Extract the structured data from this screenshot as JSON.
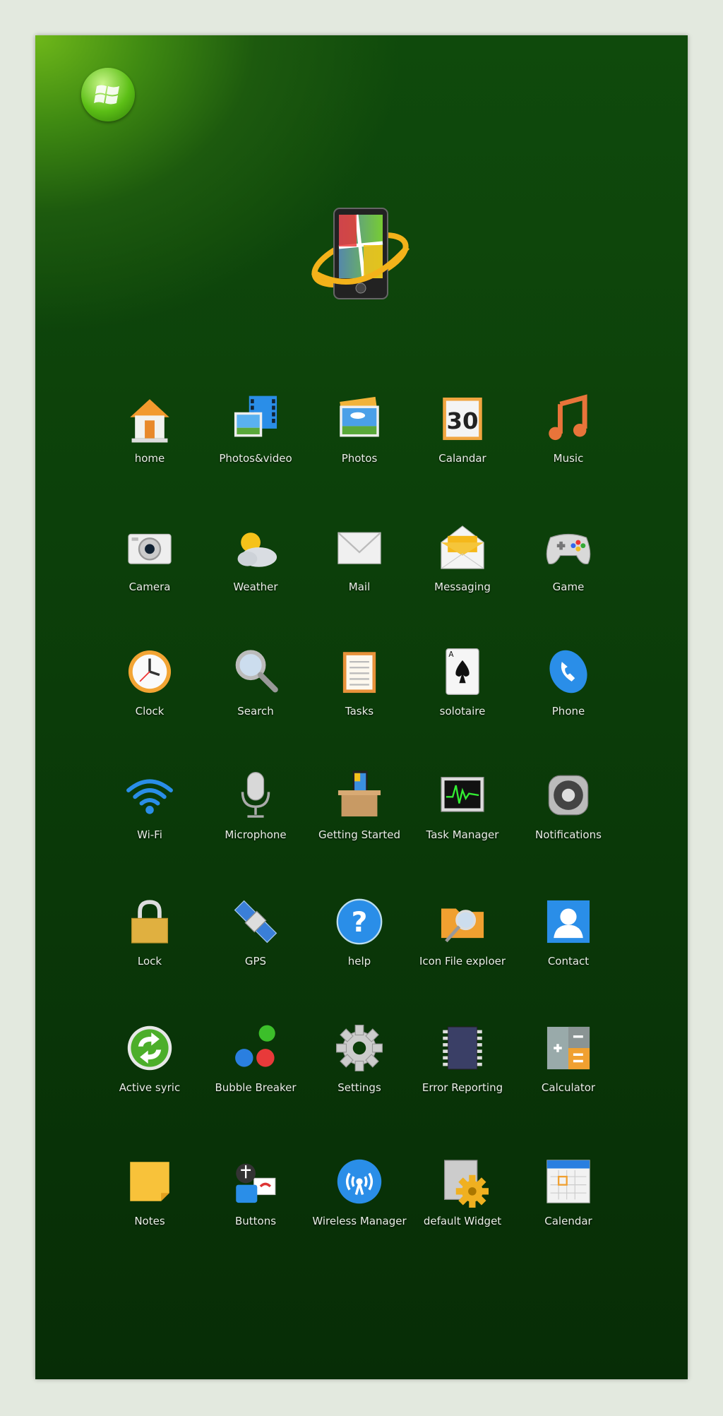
{
  "colors": {
    "background": "#0b3c09",
    "accent": "#6fb81a",
    "label": "#e9efe6"
  },
  "header": {
    "logo_icon": "windows-orb-icon",
    "hero_icon": "windows-mobile-phone-icon"
  },
  "apps": [
    {
      "label": "home",
      "icon": "home"
    },
    {
      "label": "Photos&video",
      "icon": "photos-video"
    },
    {
      "label": "Photos",
      "icon": "photos"
    },
    {
      "label": "Calandar",
      "icon": "calendar-30",
      "badge": "30"
    },
    {
      "label": "Music",
      "icon": "music"
    },
    {
      "label": "Camera",
      "icon": "camera"
    },
    {
      "label": "Weather",
      "icon": "weather"
    },
    {
      "label": "Mail",
      "icon": "mail"
    },
    {
      "label": "Messaging",
      "icon": "messaging"
    },
    {
      "label": "Game",
      "icon": "gamepad"
    },
    {
      "label": "Clock",
      "icon": "clock"
    },
    {
      "label": "Search",
      "icon": "search"
    },
    {
      "label": "Tasks",
      "icon": "tasks"
    },
    {
      "label": "solotaire",
      "icon": "card"
    },
    {
      "label": "Phone",
      "icon": "phone"
    },
    {
      "label": "Wi-Fi",
      "icon": "wifi"
    },
    {
      "label": "Microphone",
      "icon": "microphone"
    },
    {
      "label": "Getting Started",
      "icon": "getting-started"
    },
    {
      "label": "Task Manager",
      "icon": "task-manager"
    },
    {
      "label": "Notifications",
      "icon": "speaker"
    },
    {
      "label": "Lock",
      "icon": "lock"
    },
    {
      "label": "GPS",
      "icon": "satellite"
    },
    {
      "label": "help",
      "icon": "help"
    },
    {
      "label": "Icon File exploer",
      "icon": "file-explorer"
    },
    {
      "label": "Contact",
      "icon": "contact"
    },
    {
      "label": "Active syric",
      "icon": "sync"
    },
    {
      "label": "Bubble Breaker",
      "icon": "bubbles"
    },
    {
      "label": "Settings",
      "icon": "gear"
    },
    {
      "label": "Error Reporting",
      "icon": "chip"
    },
    {
      "label": "Calculator",
      "icon": "calculator"
    },
    {
      "label": "Notes",
      "icon": "notes"
    },
    {
      "label": "Buttons",
      "icon": "buttons"
    },
    {
      "label": "Wireless Manager",
      "icon": "wireless"
    },
    {
      "label": "default Widget",
      "icon": "widget"
    },
    {
      "label": "Calendar",
      "icon": "calendar"
    }
  ]
}
